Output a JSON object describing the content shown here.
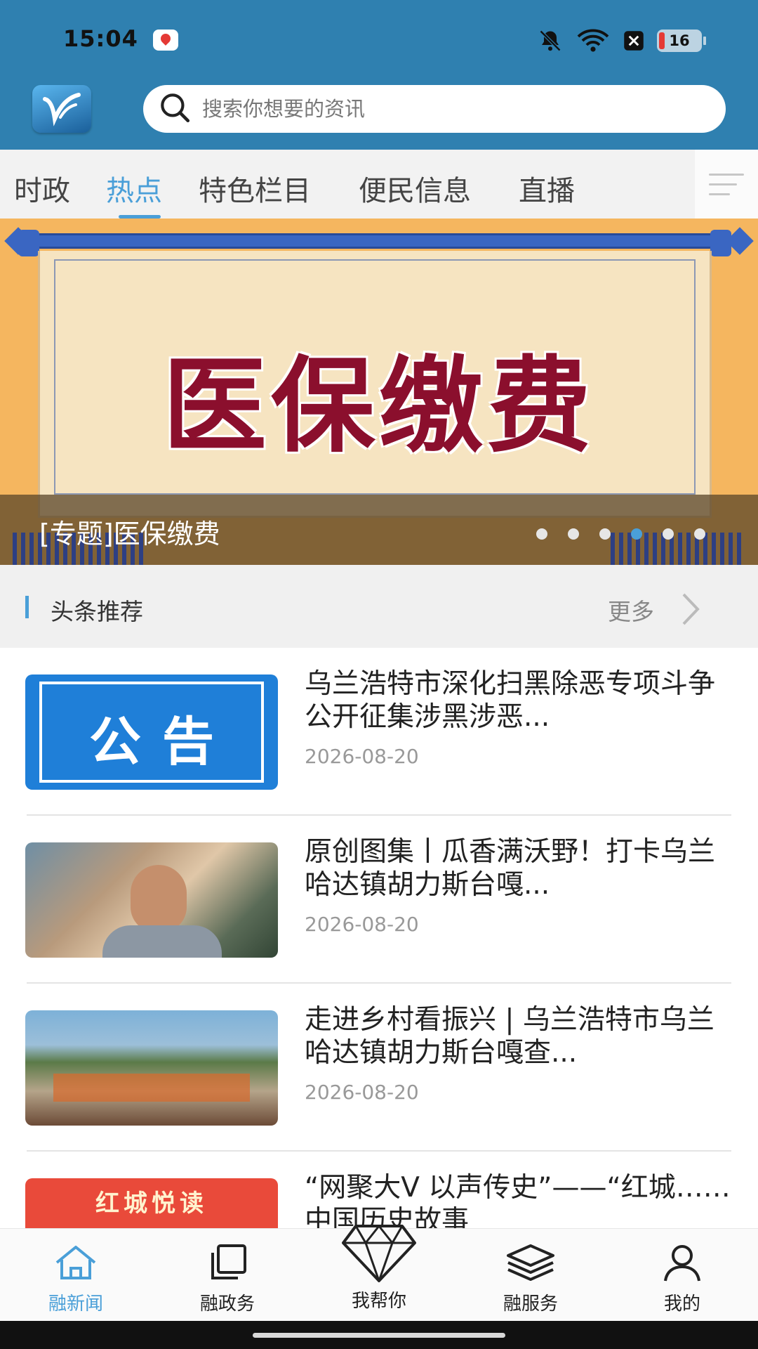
{
  "status_bar": {
    "time": "15:04",
    "battery": "16",
    "icons": [
      "du-app-icon",
      "bell-muted-icon",
      "wifi-icon",
      "close-box-icon",
      "battery-icon"
    ]
  },
  "header": {
    "logo": "app-logo",
    "search_placeholder": "搜索你想要的资讯"
  },
  "tabs": [
    {
      "label": "时政",
      "active": false
    },
    {
      "label": "热点",
      "active": true
    },
    {
      "label": "特色栏目",
      "active": false
    },
    {
      "label": "便民信息",
      "active": false
    },
    {
      "label": "直播",
      "active": false
    }
  ],
  "banner": {
    "image_text": "医保缴费",
    "caption": "[专题]医保缴费",
    "dot_count": 6,
    "active_dot_index": 3
  },
  "section": {
    "title": "头条推荐",
    "more": "更多"
  },
  "news": [
    {
      "title": "乌兰浩特市深化扫黑除恶专项斗争公开征集涉黑涉恶...",
      "date": "2026-08-20",
      "thumb_text": "公告"
    },
    {
      "title": "原创图集丨瓜香满沃野！打卡乌兰哈达镇胡力斯台嘎...",
      "date": "2026-08-20"
    },
    {
      "title": "走进乡村看振兴 | 乌兰浩特市乌兰哈达镇胡力斯台嘎查...",
      "date": "2026-08-20"
    },
    {
      "title": "“网聚大V 以声传史”——“红城……中国历史故事",
      "date": "",
      "thumb_text": "红城悦读"
    }
  ],
  "bottom_nav": [
    {
      "label": "融新闻",
      "icon": "home-icon",
      "active": true
    },
    {
      "label": "融政务",
      "icon": "layers-squares-icon",
      "active": false
    },
    {
      "label": "我帮你",
      "icon": "diamond-icon",
      "active": false
    },
    {
      "label": "融服务",
      "icon": "stack-icon",
      "active": false
    },
    {
      "label": "我的",
      "icon": "user-icon",
      "active": false
    }
  ],
  "colors": {
    "header_bg": "#2f80b0",
    "accent": "#4a9fd8",
    "banner_text": "#8b0f2d"
  }
}
